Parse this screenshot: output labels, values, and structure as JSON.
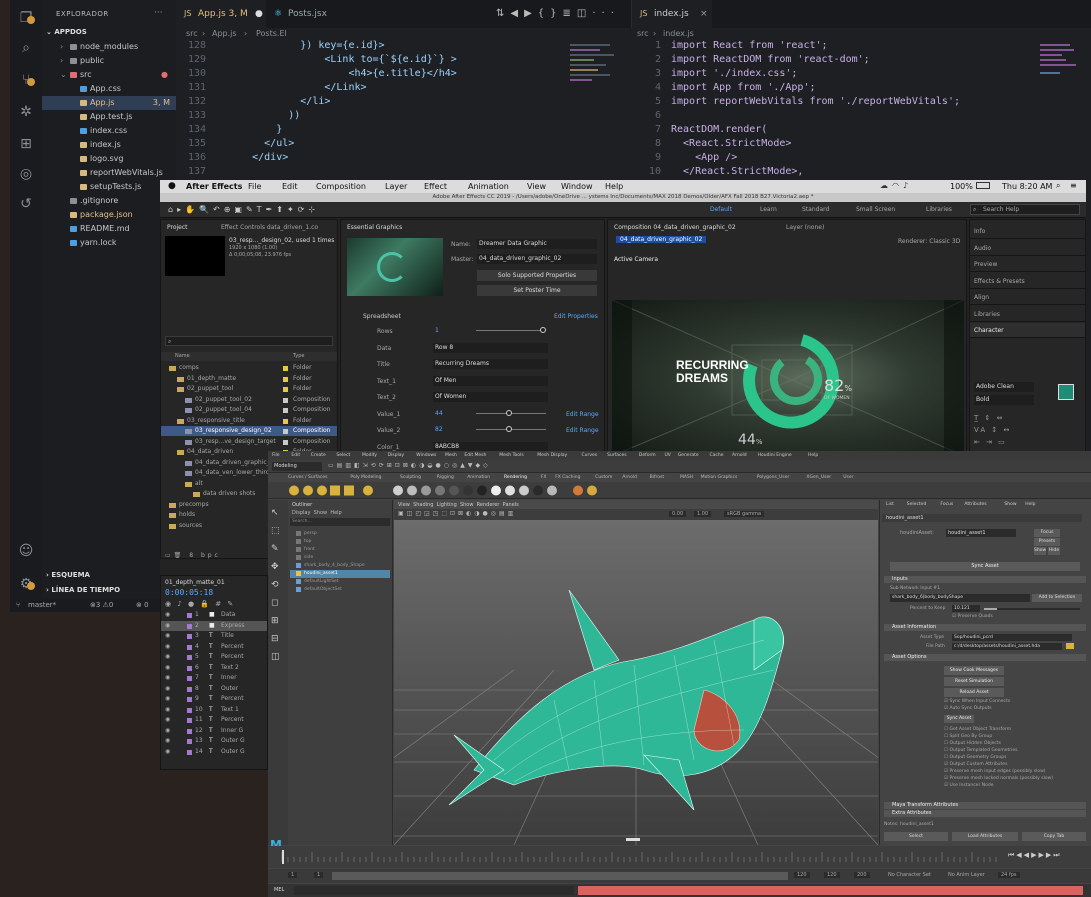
{
  "vscode": {
    "explorer_title": "EXPLORADOR",
    "project": "APPDOS",
    "tree": [
      {
        "label": "node_modules",
        "level": 1,
        "type": "folder",
        "color": "#8a8f98"
      },
      {
        "label": "public",
        "level": 1,
        "type": "folder",
        "color": "#8a8f98"
      },
      {
        "label": "src",
        "level": 1,
        "type": "folder",
        "color": "#e06c75"
      },
      {
        "label": "App.css",
        "level": 2,
        "type": "file",
        "color": "#4f9fe0"
      },
      {
        "label": "App.js",
        "level": 2,
        "type": "file",
        "color": "#d7ba7d",
        "selected": true,
        "badge": "3, M"
      },
      {
        "label": "App.test.js",
        "level": 2,
        "type": "file",
        "color": "#d7ba7d"
      },
      {
        "label": "index.css",
        "level": 2,
        "type": "file",
        "color": "#4f9fe0"
      },
      {
        "label": "index.js",
        "level": 2,
        "type": "file",
        "color": "#d7ba7d"
      },
      {
        "label": "logo.svg",
        "level": 2,
        "type": "file",
        "color": "#d7ba7d"
      },
      {
        "label": "reportWebVitals.js",
        "level": 2,
        "type": "file",
        "color": "#d7ba7d"
      },
      {
        "label": "setupTests.js",
        "level": 2,
        "type": "file",
        "color": "#d7ba7d"
      },
      {
        "label": ".gitignore",
        "level": 1,
        "type": "file",
        "color": "#8a8f98"
      },
      {
        "label": "package.json",
        "level": 1,
        "type": "file",
        "color": "#d7ba7d",
        "badge": "M"
      },
      {
        "label": "README.md",
        "level": 1,
        "type": "file",
        "color": "#4f9fe0"
      },
      {
        "label": "yarn.lock",
        "level": 1,
        "type": "file",
        "color": "#4f9fe0"
      }
    ],
    "outline_label": "ESQUEMA",
    "timeline_label": "LÍNEA DE TIEMPO",
    "status": {
      "branch": "master*",
      "problems": "⊗3 ⚠0",
      "other": "⊗ 0"
    },
    "tabs": [
      {
        "label": "App.js 3, M",
        "active": true
      },
      {
        "label": "Posts.jsx",
        "active": false
      }
    ],
    "breadcrumb": [
      "src",
      "App.js",
      "Posts.El"
    ],
    "left_code": [
      {
        "ln": "128",
        "txt": "              }) key={e.id}>"
      },
      {
        "ln": "129",
        "txt": "                  <Link to={`${e.id}`} >"
      },
      {
        "ln": "130",
        "txt": "                      <h4>{e.title}</h4>"
      },
      {
        "ln": "131",
        "txt": "                  </Link>"
      },
      {
        "ln": "132",
        "txt": "              </li>"
      },
      {
        "ln": "133",
        "txt": "            ))"
      },
      {
        "ln": "134",
        "txt": "          }"
      },
      {
        "ln": "135",
        "txt": "        </ul>"
      },
      {
        "ln": "136",
        "txt": "      </div>"
      },
      {
        "ln": "137",
        "txt": ""
      },
      {
        "ln": "138",
        "txt": ""
      },
      {
        "ln": "139",
        "txt": ""
      }
    ],
    "right_tab": "index.js",
    "right_breadcrumb": [
      "src",
      "index.js"
    ],
    "right_code": [
      {
        "ln": "1",
        "txt": "import React from 'react';"
      },
      {
        "ln": "2",
        "txt": "import ReactDOM from 'react-dom';"
      },
      {
        "ln": "3",
        "txt": "import './index.css';"
      },
      {
        "ln": "4",
        "txt": "import App from './App';"
      },
      {
        "ln": "5",
        "txt": "import reportWebVitals from './reportWebVitals';"
      },
      {
        "ln": "6",
        "txt": ""
      },
      {
        "ln": "7",
        "txt": "ReactDOM.render("
      },
      {
        "ln": "8",
        "txt": "  <React.StrictMode>"
      },
      {
        "ln": "9",
        "txt": "    <App />"
      },
      {
        "ln": "10",
        "txt": "  </React.StrictMode>,"
      }
    ]
  },
  "ae": {
    "menubar": [
      "After Effects",
      "File",
      "Edit",
      "Composition",
      "Layer",
      "Effect",
      "Animation",
      "View",
      "Window",
      "Help"
    ],
    "clock": "Thu 8:20 AM",
    "battery": "100%",
    "title": "Adobe After Effects CC 2019 - /Users/adobe/OneDrive ... ystems Inc/Documents/MAX 2018 Demos/Older/AFX Fall 2018 B27.Victoria2.aep *",
    "workspaces": [
      "Default",
      "Learn",
      "Standard",
      "Small Screen",
      "Libraries"
    ],
    "search": "Search Help",
    "project_tab": "Project",
    "effect_tab": "Effect Controls data_driven_1.co",
    "comp_thumb_name": "03_resp..._design_02",
    "comp_thumb_info": ", used 1 times",
    "comp_thumb_meta": "1920 x 1080 (1.00)",
    "comp_thumb_meta2": "Δ 0;00;05;08, 23.976 fps",
    "project_cols": [
      "Name",
      "Type"
    ],
    "project_items": [
      {
        "name": "comps",
        "type": "Folder",
        "level": 0
      },
      {
        "name": "01_depth_matte",
        "type": "Folder",
        "level": 1
      },
      {
        "name": "02_puppet_tool",
        "type": "Folder",
        "level": 1
      },
      {
        "name": "02_puppet_tool_02",
        "type": "Composition",
        "level": 2
      },
      {
        "name": "02_puppet_tool_04",
        "type": "Composition",
        "level": 2
      },
      {
        "name": "03_responsive_title",
        "type": "Folder",
        "level": 1
      },
      {
        "name": "03_responsive_design_02",
        "type": "Composition",
        "level": 2,
        "selected": true
      },
      {
        "name": "03_resp...ve_design_target",
        "type": "Composition",
        "level": 2
      },
      {
        "name": "04_data_driven",
        "type": "Folder",
        "level": 1
      },
      {
        "name": "04_data_driven_graphic_02",
        "type": "Composition",
        "level": 2
      },
      {
        "name": "04_data_ven_lower_thirds",
        "type": "Composition",
        "level": 2
      },
      {
        "name": "alt",
        "type": "Folder",
        "level": 2
      },
      {
        "name": "data driven shots",
        "type": "Folder",
        "level": 3
      },
      {
        "name": "precomps",
        "type": "Folder",
        "level": 0
      },
      {
        "name": "holds",
        "type": "Folder",
        "level": 0
      },
      {
        "name": "sources",
        "type": "Folder",
        "level": 0
      }
    ],
    "bpc": "8 bpc",
    "essential_tab": "Essential Graphics",
    "eg_name_label": "Name:",
    "eg_name": "Dreamer Data Graphic",
    "eg_master_label": "Master:",
    "eg_master": "04_data_driven_graphic_02",
    "eg_btn1": "Solo Supported Properties",
    "eg_btn2": "Set Poster Time",
    "eg_spreadsheet": "Spreadsheet",
    "eg_edit": "Edit Properties",
    "eg_props": [
      {
        "label": "Rows",
        "value": "1"
      },
      {
        "label": "Data",
        "value": "Row 8"
      },
      {
        "label": "Title",
        "value": "Recurring Dreams"
      },
      {
        "label": "Text_1",
        "value": "Of Men"
      },
      {
        "label": "Text_2",
        "value": "Of Women"
      },
      {
        "label": "Value_1",
        "value": "44"
      },
      {
        "label": "Value_2",
        "value": "82"
      },
      {
        "label": "Color_1",
        "value": "8ABCB8"
      }
    ],
    "edit_range": "Edit Range",
    "comp_tab": "Composition 04_data_driven_graphic_02",
    "layer_tab": "Layer (none)",
    "renderer": "Renderer: Classic 3D",
    "active_camera": "Active Camera",
    "comp_subtab": "04_data_driven_graphic_02",
    "viewer_title_1": "RECURRING",
    "viewer_title_2": "DREAMS",
    "viewer_pct_big": "82",
    "viewer_pct_big_label": "OF WOMEN",
    "viewer_pct_small": "44",
    "right_panels": [
      "Info",
      "Audio",
      "Preview",
      "Effects & Presets",
      "Align",
      "Libraries",
      "Character"
    ],
    "char_font": "Adobe Clean",
    "char_style": "Bold",
    "timeline_tab": "01_depth_matte_01",
    "timecode": "0:00:05:18",
    "timeline_layers": [
      {
        "num": "1",
        "name": "Data",
        "color": "#cfcfcf"
      },
      {
        "num": "2",
        "name": "Express",
        "color": "#cfcfcf"
      },
      {
        "num": "3",
        "name": "Title",
        "color": "#cfcfcf"
      },
      {
        "num": "4",
        "name": "Percent",
        "color": "#cfcfcf"
      },
      {
        "num": "5",
        "name": "Percent",
        "color": "#cfcfcf"
      },
      {
        "num": "6",
        "name": "Text 2",
        "color": "#cfcfcf"
      },
      {
        "num": "7",
        "name": "Inner",
        "color": "#cfcfcf"
      },
      {
        "num": "8",
        "name": "Outer",
        "color": "#cfcfcf"
      },
      {
        "num": "9",
        "name": "Percent",
        "color": "#cfcfcf"
      },
      {
        "num": "10",
        "name": "Text 1",
        "color": "#cfcfcf"
      },
      {
        "num": "11",
        "name": "Percent",
        "color": "#cfcfcf"
      },
      {
        "num": "12",
        "name": "Inner G",
        "color": "#cfcfcf"
      },
      {
        "num": "13",
        "name": "Outer G",
        "color": "#cfcfcf"
      },
      {
        "num": "14",
        "name": "Outer G",
        "color": "#cfcfcf"
      }
    ]
  },
  "maya": {
    "menus": [
      "File",
      "Edit",
      "Create",
      "Select",
      "Modify",
      "Display",
      "Windows",
      "Mesh",
      "Edit Mesh",
      "Mesh Tools",
      "Mesh Display",
      "Curves",
      "Surfaces",
      "Deform",
      "UV",
      "Generate",
      "Cache",
      "Arnold",
      "Houdini Engine",
      "Help"
    ],
    "workspace": "Modeling",
    "shelf_tabs": [
      "Curves / Surfaces",
      "Poly Modeling",
      "Sculpting",
      "Rigging",
      "Animation",
      "Rendering",
      "FX",
      "FX Caching",
      "Custom",
      "Arnold",
      "Bifrost",
      "MASH",
      "Motion Graphics",
      "Polygons_User",
      "XGen_User",
      "User"
    ],
    "outliner_title": "Outliner",
    "outliner_menu": [
      "Display",
      "Show",
      "Help"
    ],
    "outliner_search": "Search...",
    "outliner_items": [
      "persp",
      "top",
      "front",
      "side",
      "shark_body_4_body_Shape",
      "houdini_asset1",
      "defaultLightSet",
      "defaultObjectSet"
    ],
    "viewport_menu": [
      "View",
      "Shading",
      "Lighting",
      "Show",
      "Renderer",
      "Panels"
    ],
    "viewport_fields": [
      "0.00",
      "1.00"
    ],
    "viewport_gamma": "sRGB gamma",
    "ae_tabs": [
      "List",
      "Selected",
      "Focus",
      "Attributes",
      "Show",
      "Help"
    ],
    "ae_node": "houdini_asset1",
    "ae_node_label": "houdiniAsset:",
    "ae_btns": [
      "Focus",
      "Presets",
      "Show",
      "Hide"
    ],
    "sync_btn": "Sync Asset",
    "sections": [
      "Inputs",
      "Asset Information",
      "Asset Options"
    ],
    "input_label": "Sub Network Input #1",
    "input_value": "shark_body_6|body_bodyShape",
    "input_btn": "Add to Selection",
    "percent_label": "Percent to Keep",
    "percent_value": "10.121",
    "preserve_label": "Preserve Quads",
    "asset_type_label": "Asset Type",
    "asset_type": "Sop/houdini_pcrd",
    "file_path_label": "File Path",
    "file_path": "c:/d/desktop/assets/houdini_asset.hda",
    "opt_buttons": [
      "Show Cook Messages",
      "Reset Simulation",
      "Reload Asset"
    ],
    "opt_checks": [
      "Sync When Input Connects",
      "Auto Sync Outputs"
    ],
    "sync_outputs": "Sync Asset",
    "opt_checks2": [
      "Get Asset Object Transform",
      "Split Geo By Group",
      "Output Hidden Objects",
      "Output Templated Geometries",
      "Output Geometry Groups",
      "Output Custom Attributes",
      "Preserve mesh input edges (possibly slow)",
      "Preserve mesh locked normals (possibly slow)",
      "Use Instancer Node"
    ],
    "collapsed": [
      "Maya Transform Attributes",
      "Extra Attributes"
    ],
    "notes_label": "Notes: houdini_asset1",
    "bottom_btns": [
      "Select",
      "Load Attributes",
      "Copy Tab"
    ],
    "range_fields": [
      "1",
      "1",
      "120",
      "120",
      "200"
    ],
    "no_char_set": "No Character Set",
    "no_anim_layer": "No Anim Layer",
    "fps": "24 fps",
    "mel": "MEL",
    "brand_color": "#4bc3a7"
  }
}
